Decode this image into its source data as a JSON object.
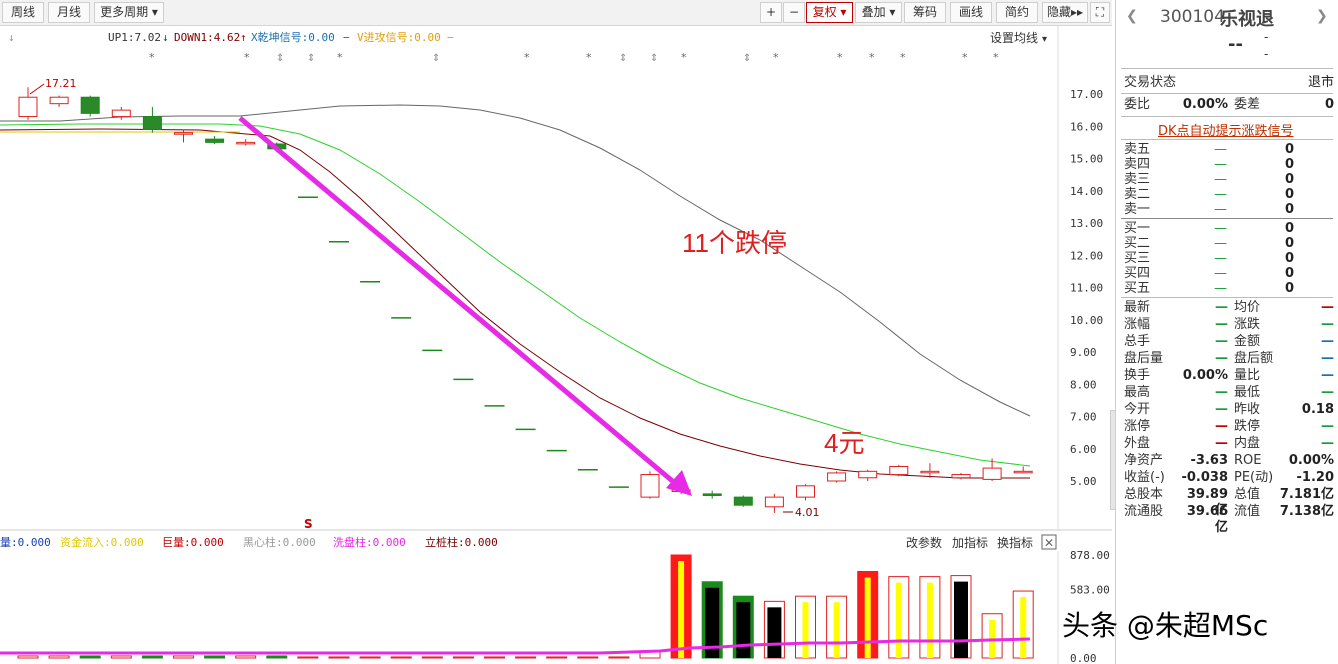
{
  "toolbar": {
    "week": "周线",
    "month": "月线",
    "more_periods": "更多周期",
    "plus": "+",
    "minus": "−",
    "adjust": "复权",
    "overlay": "叠加",
    "chips": "筹码",
    "draw": "画线",
    "simple": "简约",
    "hide": "隐藏",
    "expand_arrows": "▸▸",
    "fullscreen": "⛶"
  },
  "indicator_bar": {
    "up": "UP1:7.02",
    "down": "DOWN1:4.62",
    "x_signal": "X乾坤信号:0.00",
    "v_signal": "V进攻信号:0.00",
    "set_ma": "设置均线"
  },
  "annotations": {
    "high_label": "17.21",
    "low_label": "4.01",
    "text1": "11个跌停",
    "text2": "4元",
    "s_marker": "S"
  },
  "volume_bar": {
    "items": [
      "量:0.000",
      "资金流入:0.000",
      "巨量:0.000",
      "黑心柱:0.000",
      "洗盘柱:0.000",
      "立桩柱:0.000"
    ],
    "change_params": "改参数",
    "add_indicator": "加指标",
    "switch_indicator": "换指标"
  },
  "watermark": "头条 @朱超MSc",
  "panel": {
    "code": "300104",
    "name": "乐视退",
    "price": "--",
    "dash": "-",
    "trade_state_label": "交易状态",
    "trade_state": "退市",
    "ratio_label": "委比",
    "ratio": "0.00%",
    "diff_label": "委差",
    "diff": "0",
    "signal_link": "DK点自动提示涨跌信号",
    "sells": [
      {
        "label": "卖五",
        "vol": "0"
      },
      {
        "label": "卖四",
        "vol": "0"
      },
      {
        "label": "卖三",
        "vol": "0"
      },
      {
        "label": "卖二",
        "vol": "0"
      },
      {
        "label": "卖一",
        "vol": "0"
      }
    ],
    "buys": [
      {
        "label": "买一",
        "vol": "0"
      },
      {
        "label": "买二",
        "vol": "0"
      },
      {
        "label": "买三",
        "vol": "0"
      },
      {
        "label": "买四",
        "vol": "0"
      },
      {
        "label": "买五",
        "vol": "0"
      }
    ],
    "stats": [
      {
        "l1": "最新",
        "v1": "—",
        "l2": "均价",
        "v2": "—"
      },
      {
        "l1": "涨幅",
        "v1": "—",
        "l2": "涨跌",
        "v2": "—"
      },
      {
        "l1": "总手",
        "v1": "—",
        "l2": "金额",
        "v2": "—"
      },
      {
        "l1": "盘后量",
        "v1": "—",
        "l2": "盘后额",
        "v2": "—"
      },
      {
        "l1": "换手",
        "v1": "0.00%",
        "l2": "量比",
        "v2": "—"
      },
      {
        "l1": "最高",
        "v1": "—",
        "l2": "最低",
        "v2": "—"
      },
      {
        "l1": "今开",
        "v1": "—",
        "l2": "昨收",
        "v2": "0.18"
      },
      {
        "l1": "涨停",
        "v1": "—",
        "l2": "跌停",
        "v2": "—"
      },
      {
        "l1": "外盘",
        "v1": "—",
        "l2": "内盘",
        "v2": "—"
      },
      {
        "l1": "净资产",
        "v1": "-3.63",
        "l2": "ROE",
        "v2": "0.00%"
      },
      {
        "l1": "收益(-)",
        "v1": "-0.038",
        "l2": "PE(动)",
        "v2": "-1.20"
      },
      {
        "l1": "总股本",
        "v1": "39.89亿",
        "l2": "总值",
        "v2": "7.181亿"
      },
      {
        "l1": "流通股",
        "v1": "39.66亿",
        "l2": "流值",
        "v2": "7.138亿"
      }
    ]
  },
  "chart_data": {
    "type": "candlestick",
    "y_ticks": [
      "17.00",
      "16.00",
      "15.00",
      "14.00",
      "13.00",
      "12.00",
      "11.00",
      "10.00",
      "9.00",
      "8.00",
      "7.00",
      "6.00",
      "5.00"
    ],
    "ylim": [
      4.0,
      17.4
    ],
    "candles": [
      {
        "o": 16.3,
        "c": 16.9,
        "h": 17.21,
        "l": 16.2
      },
      {
        "o": 16.7,
        "c": 16.9,
        "h": 16.95,
        "l": 16.6
      },
      {
        "o": 16.9,
        "c": 16.4,
        "h": 16.95,
        "l": 16.3
      },
      {
        "o": 16.3,
        "c": 16.5,
        "h": 16.6,
        "l": 16.2
      },
      {
        "o": 16.3,
        "c": 15.9,
        "h": 16.6,
        "l": 15.8
      },
      {
        "o": 15.8,
        "c": 15.8,
        "h": 15.9,
        "l": 15.5
      },
      {
        "o": 15.6,
        "c": 15.5,
        "h": 15.7,
        "l": 15.45
      },
      {
        "o": 15.5,
        "c": 15.5,
        "h": 15.6,
        "l": 15.4
      },
      {
        "o": 15.45,
        "c": 15.3,
        "h": 15.5,
        "l": 15.2
      },
      {
        "o": 13.8,
        "c": 13.8,
        "h": 13.8,
        "l": 13.8
      },
      {
        "o": 12.42,
        "c": 12.42,
        "h": 12.42,
        "l": 12.42
      },
      {
        "o": 11.18,
        "c": 11.18,
        "h": 11.18,
        "l": 11.18
      },
      {
        "o": 10.06,
        "c": 10.06,
        "h": 10.06,
        "l": 10.06
      },
      {
        "o": 9.05,
        "c": 9.05,
        "h": 9.05,
        "l": 9.05
      },
      {
        "o": 8.15,
        "c": 8.15,
        "h": 8.15,
        "l": 8.15
      },
      {
        "o": 7.33,
        "c": 7.33,
        "h": 7.33,
        "l": 7.33
      },
      {
        "o": 6.6,
        "c": 6.6,
        "h": 6.6,
        "l": 6.6
      },
      {
        "o": 5.94,
        "c": 5.94,
        "h": 5.94,
        "l": 5.94
      },
      {
        "o": 5.35,
        "c": 5.35,
        "h": 5.35,
        "l": 5.35
      },
      {
        "o": 4.81,
        "c": 4.81,
        "h": 4.81,
        "l": 4.81
      },
      {
        "o": 4.5,
        "c": 5.2,
        "h": 5.3,
        "l": 4.45
      },
      {
        "o": 4.72,
        "c": 4.72,
        "h": 4.85,
        "l": 4.6
      },
      {
        "o": 4.6,
        "c": 4.55,
        "h": 4.7,
        "l": 4.45
      },
      {
        "o": 4.5,
        "c": 4.25,
        "h": 4.55,
        "l": 4.2
      },
      {
        "o": 4.2,
        "c": 4.5,
        "h": 4.6,
        "l": 4.01
      },
      {
        "o": 4.5,
        "c": 4.85,
        "h": 4.9,
        "l": 4.4
      },
      {
        "o": 5.0,
        "c": 5.25,
        "h": 5.3,
        "l": 4.95
      },
      {
        "o": 5.1,
        "c": 5.3,
        "h": 5.35,
        "l": 5.0
      },
      {
        "o": 5.2,
        "c": 5.45,
        "h": 5.5,
        "l": 5.15
      },
      {
        "o": 5.3,
        "c": 5.3,
        "h": 5.55,
        "l": 5.1
      },
      {
        "o": 5.1,
        "c": 5.2,
        "h": 5.25,
        "l": 5.05
      },
      {
        "o": 5.05,
        "c": 5.4,
        "h": 5.7,
        "l": 5.0
      },
      {
        "o": 5.3,
        "c": 5.3,
        "h": 5.45,
        "l": 5.25
      }
    ],
    "volume_ticks": [
      "878.00",
      "583.00",
      "0.00"
    ],
    "volumes": [
      0.02,
      0.02,
      0.02,
      0.02,
      0.02,
      0.02,
      0.02,
      0.02,
      0.02,
      0.01,
      0.01,
      0.01,
      0.01,
      0.01,
      0.01,
      0.01,
      0.01,
      0.01,
      0.01,
      0.01,
      0.07,
      1.0,
      0.74,
      0.6,
      0.55,
      0.6,
      0.6,
      0.84,
      0.79,
      0.79,
      0.8,
      0.43,
      0.65
    ]
  }
}
